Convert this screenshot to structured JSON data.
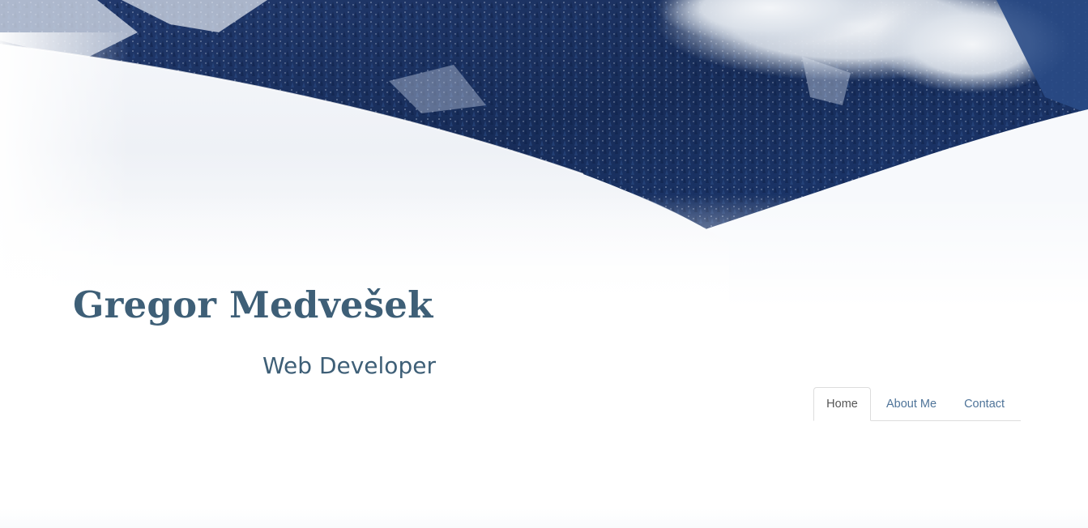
{
  "header": {
    "background": "snowy-mountain-forest-image",
    "title": "Gregor Medvešek",
    "subtitle": "Web Developer"
  },
  "nav": {
    "tabs": [
      {
        "label": "Home",
        "active": true
      },
      {
        "label": "About Me",
        "active": false
      },
      {
        "label": "Contact",
        "active": false
      }
    ]
  },
  "colors": {
    "title": "#3e5f77",
    "link": "#4f7499",
    "active_tab_text": "#555555",
    "tab_border": "#dddddd"
  }
}
